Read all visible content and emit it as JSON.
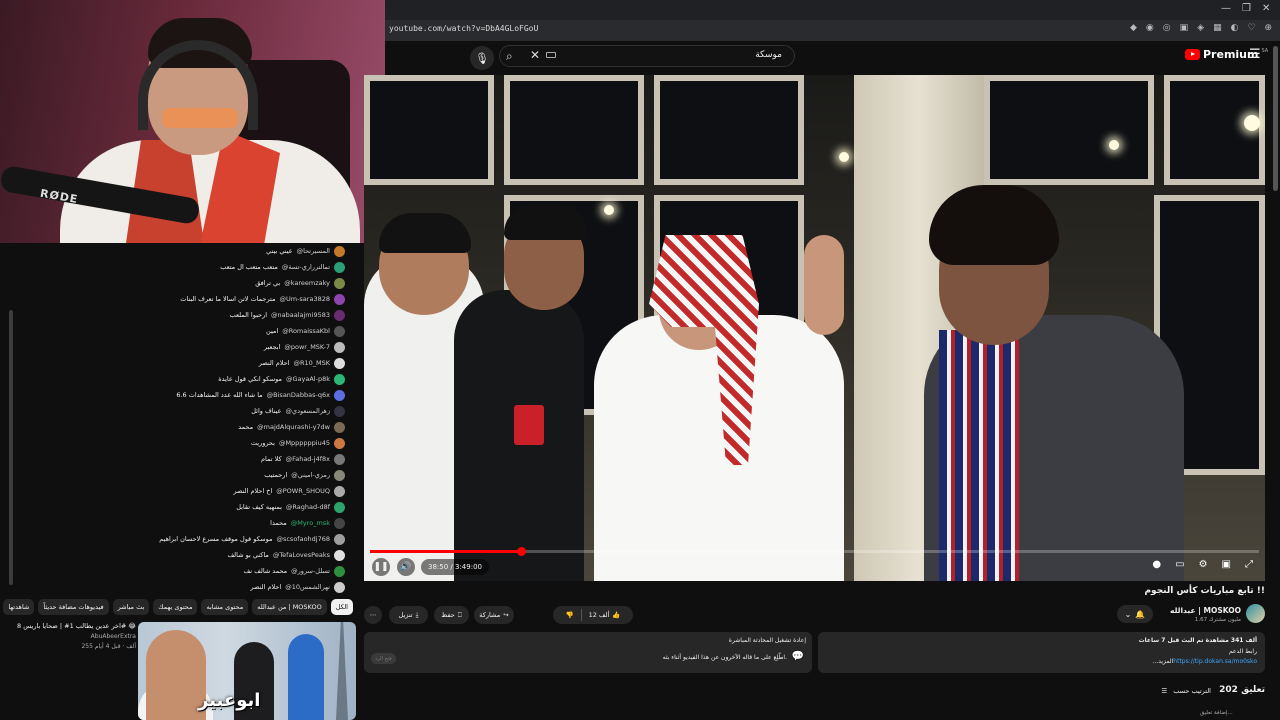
{
  "browser": {
    "url": "youtube.com/watch?v=DbA4GLoFGoU"
  },
  "youtube": {
    "search_value": "موسكة",
    "premium_label": "Premium",
    "region": "SA"
  },
  "webcam": {
    "mic_brand": "RØDE"
  },
  "chat": {
    "messages": [
      {
        "user": "@المسيرتحا",
        "text": "عيني بيني",
        "avatar": "#c47a2c"
      },
      {
        "user": "@تمالترراري-تسة",
        "text": "متعب متعب ال متعب",
        "avatar": "#2b9e77"
      },
      {
        "user": "@kareemzaky",
        "text": "بي ترافق",
        "avatar": "#7a8a45"
      },
      {
        "user": "@Um-sara3828",
        "text": "مترجمات لاتن اسالا ما تعرف البنات",
        "avatar": "#8e44ad"
      },
      {
        "user": "@nabaalajmi9583",
        "text": "ارحبوا الملعب",
        "avatar": "#6a2c70"
      },
      {
        "user": "@RomaissaKbl",
        "text": "امين",
        "avatar": "#555555"
      },
      {
        "user": "@powr_MSK-7",
        "text": "ابجعبر",
        "avatar": "#bbbbbb"
      },
      {
        "user": "@R10_MSK",
        "text": "احلام النصر",
        "avatar": "#dddddd"
      },
      {
        "user": "@GayaAl-p8k",
        "text": "موسكو انكي قول عايدة",
        "avatar": "#2bb673"
      },
      {
        "user": "@BisanDabbas-q6x",
        "text": "ما شاء الله عدد المشاهدات 6.6",
        "avatar": "#5b6ee1"
      },
      {
        "user": "@زهرالمسعودي",
        "text": "عيناف وائل",
        "avatar": "#333344"
      },
      {
        "user": "@majdAlqurashi-y7dw",
        "text": "محمد",
        "avatar": "#7a6a55"
      },
      {
        "user": "@Mppppppiu45",
        "text": "بحروريت",
        "avatar": "#cc7744"
      },
      {
        "user": "@Fahad-j4f8x",
        "text": "كلا تمام",
        "avatar": "#777777"
      },
      {
        "user": "@رمزي-اميني",
        "text": "ارحمتيب",
        "avatar": "#888877"
      },
      {
        "user": "@POWR_SHOUQ",
        "text": "اخ احلام النصر",
        "avatar": "#aaaaaa"
      },
      {
        "user": "@Raghad-d8f",
        "text": "بمنهيه كيف تقابل",
        "avatar": "#2ea36b"
      },
      {
        "user": "@Myro_msk",
        "text": "محمدا",
        "avatar": "#444444",
        "green": true
      },
      {
        "user": "@scsofaohdj768",
        "text": "موسكو قول موقف مسرع لاحسان ابراهيم",
        "avatar": "#9e9e9e"
      },
      {
        "user": "@TefaLovesPeaks",
        "text": "ماكني بو شالف",
        "avatar": "#e0e0e0"
      },
      {
        "user": "@تسلل-سرور",
        "text": "محمد شالف نف",
        "avatar": "#2f8f3f"
      },
      {
        "user": "@نهرالشمس10",
        "text": "احلام النصر",
        "avatar": "#cccccc"
      }
    ]
  },
  "chips": [
    "الكل",
    "من عبدالله | MOSKOO",
    "محتوى مشابه",
    "محتوى يهمك",
    "بث مباشر",
    "فيديوهات مضافة حديثاً",
    "شاهدتها"
  ],
  "recommended": {
    "title": "اخر عدين يطالب 1# | ضحايا باريس 8# 😂",
    "channel": "AbuAbeerExtra",
    "meta": "255 ألف · قبل 4 أيام",
    "thumb_text": "ابوعبير"
  },
  "player": {
    "current_time": "38:50",
    "duration": "3:49:00",
    "progress": 0.1695
  },
  "video": {
    "title": "تابع مباريات كأس النجوم !!",
    "channel_name": "عبدالله | MOSKOO",
    "subscribers": "1.67 مليون مشترك",
    "likes": "12 ألف",
    "share_label": "مشاركة",
    "save_label": "حفظ",
    "download_label": "تنزيل"
  },
  "description": {
    "line1": "ألف 341 مشاهدة تم البث قبل 7 ساعات",
    "line2": "رابط الدعم",
    "link": "https://tip.dokan.sa/mo0sko",
    "more": "...المزيد"
  },
  "chat_replay": {
    "title": "إعادة تشغيل المحادثة المباشرة",
    "text": "اطّلِع على ما قاله الآخرون عن هذا الفيديو أثناء بثه.",
    "button": "فتح الرد"
  },
  "comments": {
    "count": "202 تعليق",
    "sort_label": "الترتيب حسب",
    "add_placeholder": "إضافة تعليق..."
  }
}
